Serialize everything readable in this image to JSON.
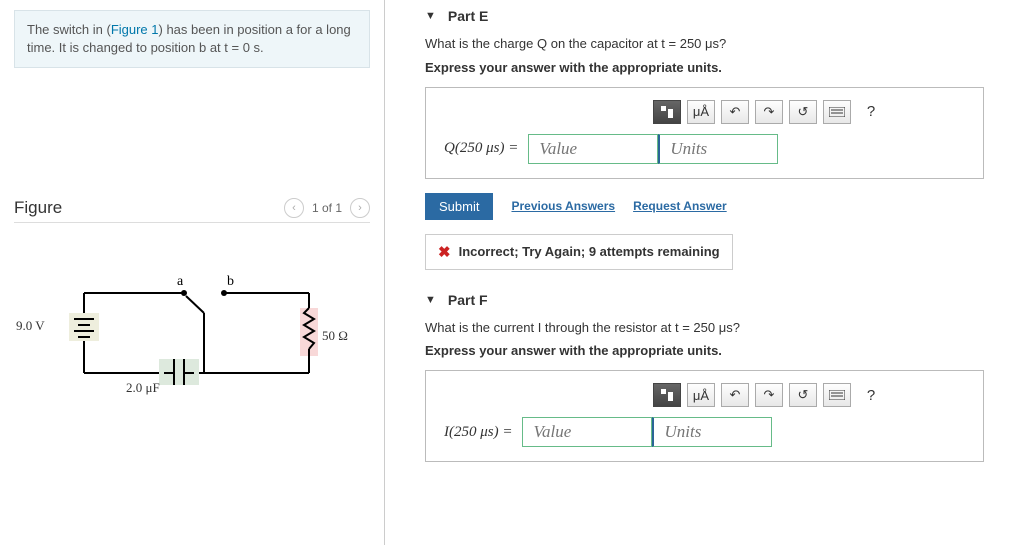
{
  "prompt": {
    "prefix": "The switch in (",
    "figlink": "Figure 1",
    "middle": ") has been in position a for a long time. It is changed to position b at t = 0 s."
  },
  "figure": {
    "title": "Figure",
    "pager": "1 of 1",
    "labels": {
      "voltage": "9.0 V",
      "cap": "2.0 μF",
      "res": "50 Ω",
      "a": "a",
      "b": "b"
    }
  },
  "partE": {
    "title": "Part E",
    "question": "What is the charge Q on the capacitor at t = 250 μs?",
    "instruction": "Express your answer with the appropriate units.",
    "eq": "Q(250 μs) =",
    "valuePlaceholder": "Value",
    "unitsPlaceholder": "Units",
    "muA": "μÅ",
    "submit": "Submit",
    "prev": "Previous Answers",
    "req": "Request Answer",
    "feedback": "Incorrect; Try Again; 9 attempts remaining"
  },
  "partF": {
    "title": "Part F",
    "question": "What is the current I through the resistor at t = 250 μs?",
    "instruction": "Express your answer with the appropriate units.",
    "eq": "I(250 μs) =",
    "valuePlaceholder": "Value",
    "unitsPlaceholder": "Units",
    "muA": "μÅ"
  },
  "toolbar": {
    "help": "?"
  }
}
